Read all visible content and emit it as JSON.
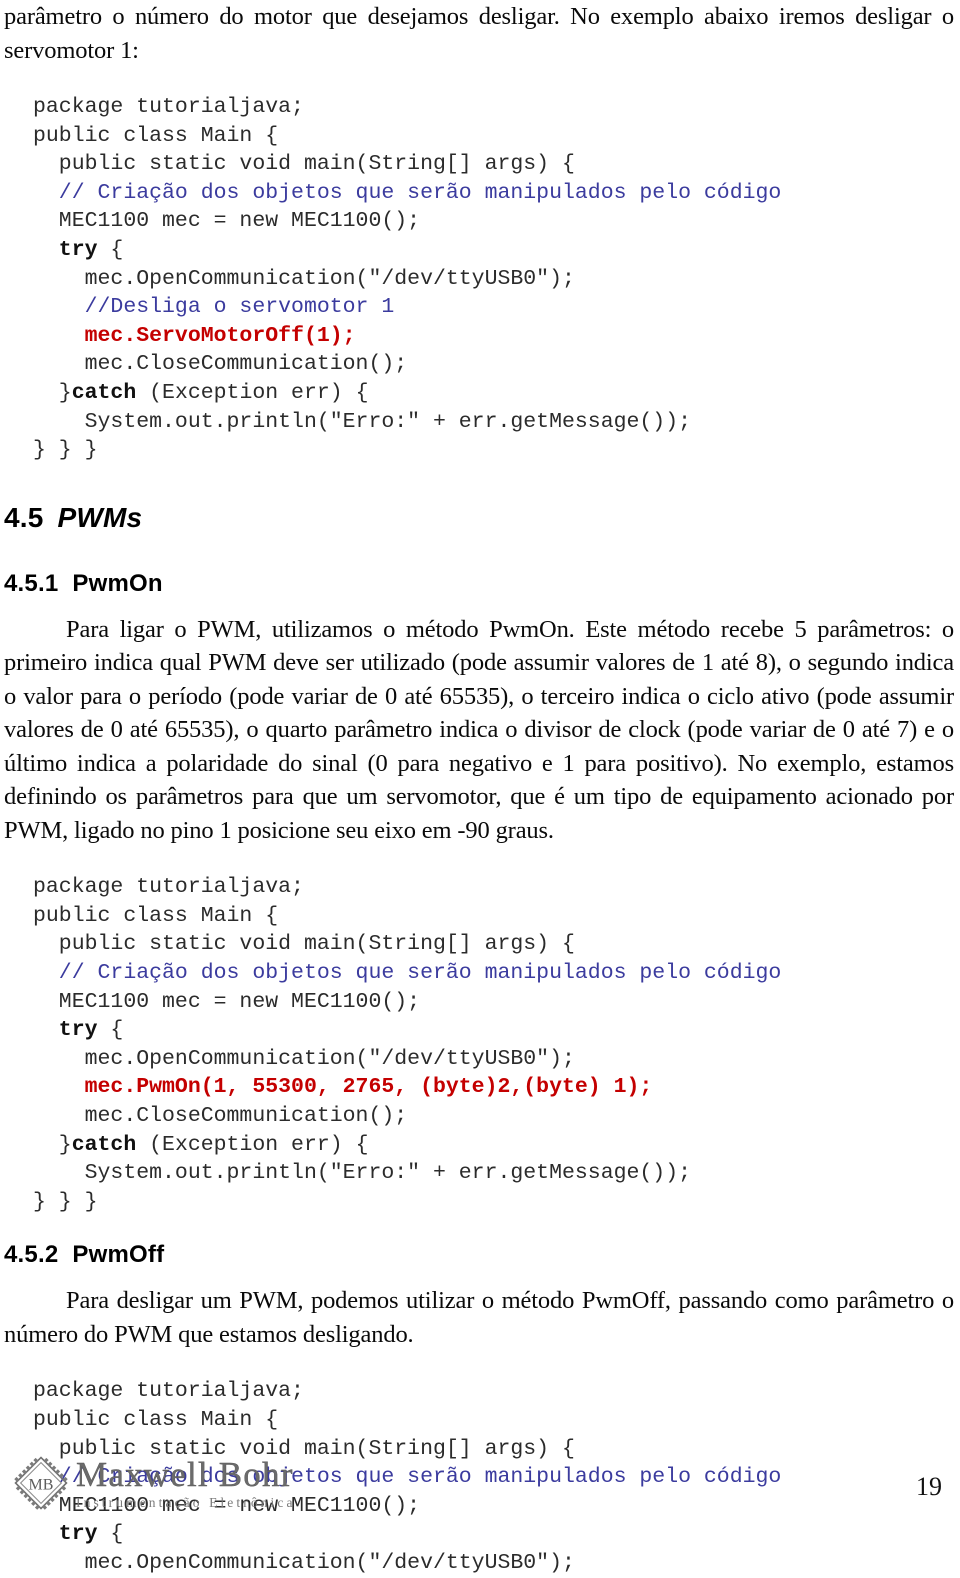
{
  "document": {
    "page_number": "19"
  },
  "intro_paragraph": "parâmetro o número do motor que desejamos desligar. No exemplo abaixo iremos desligar o servomotor 1:",
  "code_servo_off": {
    "lines": [
      [
        {
          "t": "package tutorialjava;",
          "s": "plain"
        }
      ],
      [
        {
          "t": "public class Main {",
          "s": "plain"
        }
      ],
      [
        {
          "t": "  public static void main(String[] args) {",
          "s": "plain"
        }
      ],
      [
        {
          "t": "  // Criação dos objetos que serão manipulados pelo código",
          "s": "cmt"
        }
      ],
      [
        {
          "t": "  MEC1100 mec = new MEC1100();",
          "s": "plain"
        }
      ],
      [
        {
          "t": "  try",
          "s": "kw"
        },
        {
          "t": " {",
          "s": "plain"
        }
      ],
      [
        {
          "t": "    mec.OpenCommunication(\"/dev/ttyUSB0\");",
          "s": "plain"
        }
      ],
      [
        {
          "t": "    //Desliga o servomotor 1",
          "s": "cmt"
        }
      ],
      [
        {
          "t": "    mec.ServoMotorOff(1);",
          "s": "hl"
        }
      ],
      [
        {
          "t": "    mec.CloseCommunication();",
          "s": "plain"
        }
      ],
      [
        {
          "t": "  }",
          "s": "plain"
        },
        {
          "t": "catch",
          "s": "kw"
        },
        {
          "t": " (Exception err) {",
          "s": "plain"
        }
      ],
      [
        {
          "t": "    System.out.println(\"Erro:\" + err.getMessage());",
          "s": "plain"
        }
      ],
      [
        {
          "t": "} } }",
          "s": "plain"
        }
      ]
    ]
  },
  "section_pwms": {
    "number": "4.5",
    "title": "PWMs"
  },
  "section_pwmon": {
    "number": "4.5.1",
    "title": "PwmOn",
    "paragraph": "Para ligar o PWM, utilizamos o método PwmOn. Este método recebe 5 parâmetros: o primeiro indica qual PWM deve ser utilizado (pode assumir valores de 1 até 8), o segundo indica o valor para o período (pode variar de 0 até 65535), o terceiro indica o ciclo ativo (pode assumir valores de 0 até 65535), o quarto parâmetro indica o divisor de clock (pode variar de 0 até 7) e o último indica a polaridade do sinal (0 para negativo e 1 para positivo). No exemplo, estamos definindo os parâmetros para que um servomotor, que é um tipo de equipamento acionado por PWM, ligado no pino 1 posicione seu eixo em -90 graus."
  },
  "code_pwm_on": {
    "lines": [
      [
        {
          "t": "package tutorialjava;",
          "s": "plain"
        }
      ],
      [
        {
          "t": "public class Main {",
          "s": "plain"
        }
      ],
      [
        {
          "t": "  public static void main(String[] args) {",
          "s": "plain"
        }
      ],
      [
        {
          "t": "  // Criação dos objetos que serão manipulados pelo código",
          "s": "cmt"
        }
      ],
      [
        {
          "t": "  MEC1100 mec = new MEC1100();",
          "s": "plain"
        }
      ],
      [
        {
          "t": "  try",
          "s": "kw"
        },
        {
          "t": " {",
          "s": "plain"
        }
      ],
      [
        {
          "t": "    mec.OpenCommunication(\"/dev/ttyUSB0\");",
          "s": "plain"
        }
      ],
      [
        {
          "t": "    mec.PwmOn(1, 55300, 2765, (byte)2,(byte) 1);",
          "s": "hl"
        }
      ],
      [
        {
          "t": "    mec.CloseCommunication();",
          "s": "plain"
        }
      ],
      [
        {
          "t": "  }",
          "s": "plain"
        },
        {
          "t": "catch",
          "s": "kw"
        },
        {
          "t": " (Exception err) {",
          "s": "plain"
        }
      ],
      [
        {
          "t": "    System.out.println(\"Erro:\" + err.getMessage());",
          "s": "plain"
        }
      ],
      [
        {
          "t": "} } }",
          "s": "plain"
        }
      ]
    ]
  },
  "section_pwmoff": {
    "number": "4.5.2",
    "title": "PwmOff",
    "paragraph": "Para desligar um PWM, podemos utilizar o método PwmOff, passando como parâmetro o número do PWM que estamos desligando."
  },
  "code_pwm_off": {
    "lines": [
      [
        {
          "t": "package tutorialjava;",
          "s": "plain"
        }
      ],
      [
        {
          "t": "public class Main {",
          "s": "plain"
        }
      ],
      [
        {
          "t": "  public static void main(String[] args) {",
          "s": "plain"
        }
      ],
      [
        {
          "t": "  // Criação dos objetos que serão manipulados pelo código",
          "s": "cmt"
        }
      ],
      [
        {
          "t": "  MEC1100 mec = new MEC1100();",
          "s": "plain"
        }
      ],
      [
        {
          "t": "  try",
          "s": "kw"
        },
        {
          "t": " {",
          "s": "plain"
        }
      ],
      [
        {
          "t": "    mec.OpenCommunication(\"/dev/ttyUSB0\");",
          "s": "plain"
        }
      ]
    ]
  },
  "footer": {
    "logo_name": "Maxwell Bohr",
    "logo_subtitle": "Instrumentação Eletrônica",
    "logo_mark_text": "MB",
    "page_number": "19"
  },
  "colors": {
    "comment": "#3b3b9e",
    "highlight": "#c40000",
    "code": "#2b2b2b",
    "logo": "#6b6b6b"
  }
}
